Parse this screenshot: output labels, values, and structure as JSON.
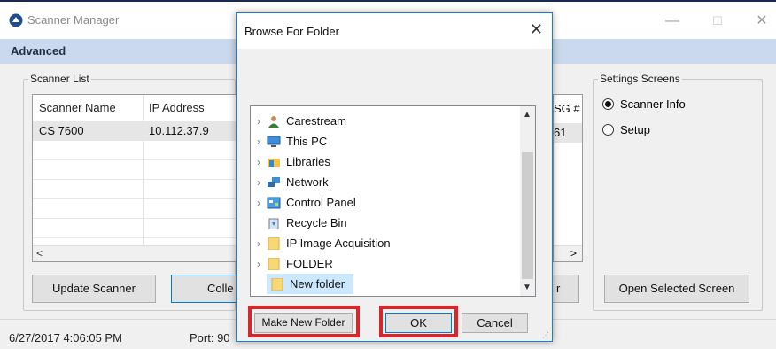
{
  "main_window": {
    "title": "Scanner Manager",
    "minimize": "—",
    "maximize": "☐",
    "close": "✕",
    "advanced_label": "Advanced"
  },
  "scanner_list": {
    "group_title": "Scanner List",
    "columns": [
      "Scanner Name",
      "IP Address"
    ],
    "rows": [
      {
        "name": "CS 7600",
        "ip": "10.112.37.9"
      }
    ],
    "right_column_header_fragment": "SG #",
    "right_cell_fragment": "61",
    "scroll_left": "<",
    "scroll_right": ">"
  },
  "buttons": {
    "update_scanner": "Update Scanner",
    "collect_fragment": "Colle",
    "fragment_right": "r",
    "open_selected_screen": "Open Selected Screen"
  },
  "settings_screens": {
    "group_title": "Settings Screens",
    "options": [
      {
        "label": "Scanner Info",
        "checked": true
      },
      {
        "label": "Setup",
        "checked": false
      }
    ]
  },
  "status_bar": {
    "datetime": "6/27/2017 4:06:05 PM",
    "port_fragment": "Port: 90"
  },
  "dialog": {
    "title": "Browse For Folder",
    "close": "✕",
    "tree": [
      {
        "label": "Carestream",
        "icon": "user-folder-icon",
        "expandable": true,
        "selected": false
      },
      {
        "label": "This PC",
        "icon": "computer-icon",
        "expandable": true,
        "selected": false
      },
      {
        "label": "Libraries",
        "icon": "libraries-icon",
        "expandable": true,
        "selected": false
      },
      {
        "label": "Network",
        "icon": "network-icon",
        "expandable": true,
        "selected": false
      },
      {
        "label": "Control Panel",
        "icon": "control-panel-icon",
        "expandable": true,
        "selected": false
      },
      {
        "label": "Recycle Bin",
        "icon": "recycle-bin-icon",
        "expandable": false,
        "selected": false
      },
      {
        "label": "IP Image Acquisition",
        "icon": "folder-icon",
        "expandable": true,
        "selected": false
      },
      {
        "label": "FOLDER",
        "icon": "folder-icon",
        "expandable": true,
        "selected": false
      },
      {
        "label": "New folder",
        "icon": "folder-icon",
        "expandable": false,
        "selected": true
      }
    ],
    "make_new_folder": "Make New Folder",
    "ok": "OK",
    "cancel": "Cancel"
  },
  "colors": {
    "highlight_red": "#d9262c",
    "header_bar": "#cad9ee",
    "selection_blue": "#cce8ff"
  }
}
